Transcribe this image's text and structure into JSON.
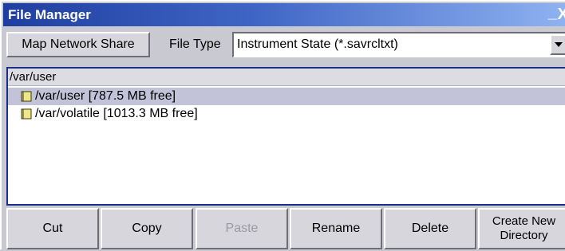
{
  "window": {
    "title": "File Manager",
    "minimize_glyph": "_",
    "close_glyph": "X"
  },
  "toolbar": {
    "map_network_share": "Map Network Share",
    "file_type_label": "File Type",
    "file_type_value": "Instrument State (*.savrcltxt)"
  },
  "browser": {
    "current_path": "/var/user",
    "items": [
      {
        "label": "/var/user  [787.5 MB free]",
        "selected": true,
        "icon": "folder-icon"
      },
      {
        "label": "/var/volatile  [1013.3 MB free]",
        "selected": false,
        "icon": "folder-icon"
      }
    ]
  },
  "actions": {
    "cut": "Cut",
    "copy": "Copy",
    "paste": "Paste",
    "paste_enabled": false,
    "rename": "Rename",
    "delete": "Delete",
    "create_dir_line1": "Create New",
    "create_dir_line2": "Directory"
  },
  "colors": {
    "titlebar_start": "#1f3ea0",
    "titlebar_end": "#8fb2f0",
    "selection": "#c2c2d8",
    "browser_border": "#1a2f8a"
  }
}
